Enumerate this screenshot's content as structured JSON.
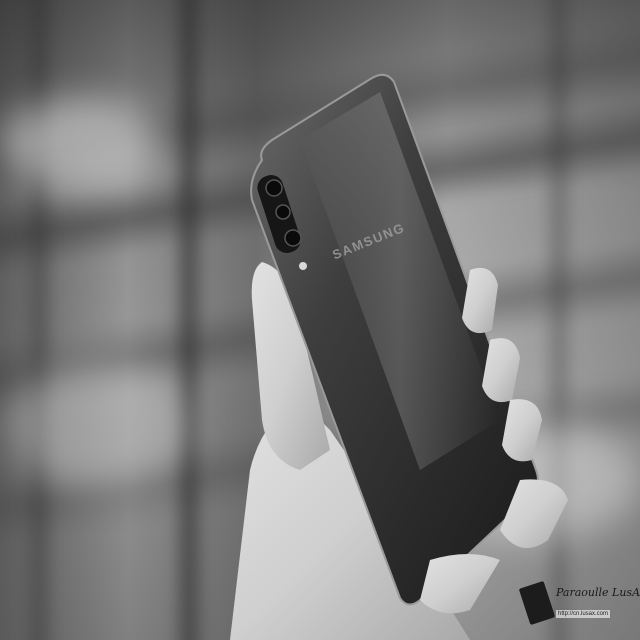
{
  "photo": {
    "subject": "smartphone-back",
    "brand_text": "SAMSUNG",
    "watermark": {
      "text": "Paraoulle LusAX",
      "sub_text": "http://cn.lusax.com"
    }
  }
}
